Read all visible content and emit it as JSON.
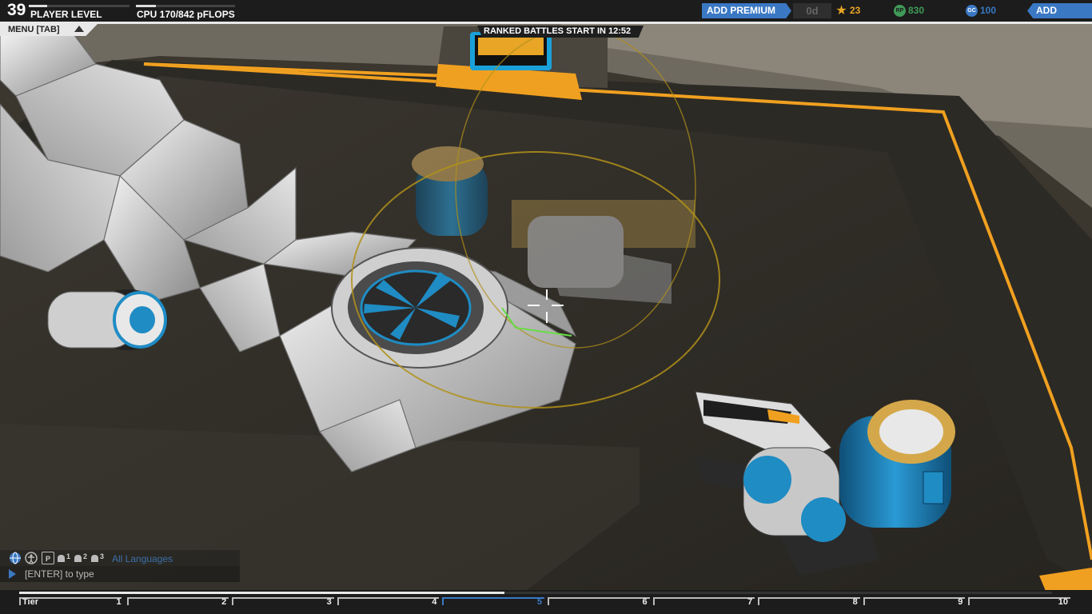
{
  "player": {
    "level": "39",
    "level_label": "PLAYER LEVEL",
    "level_progress": 0.18
  },
  "cpu": {
    "label": "CPU 170/842 pFLOPS",
    "progress": 0.2
  },
  "premium": {
    "button_label": "ADD PREMIUM",
    "days": "0d"
  },
  "currencies": [
    {
      "name": "star",
      "icon": "star-icon",
      "value": "23",
      "color": "#e8a526"
    },
    {
      "name": "rp",
      "icon": "rp-icon",
      "value": "830",
      "color": "#3f9a58",
      "icon_text": "RP"
    },
    {
      "name": "gc",
      "icon": "gc-icon",
      "value": "100",
      "color": "#3a78c4",
      "icon_text": "GC"
    }
  ],
  "funds": {
    "button_label": "ADD FUNDS"
  },
  "menu": {
    "label": "MENU [TAB]"
  },
  "ranked": {
    "label": "RANKED BATTLES START IN 12:52"
  },
  "chat": {
    "icons": [
      "globe-icon",
      "person-icon",
      "party-icon",
      "user1-icon",
      "user2-icon",
      "user3-icon"
    ],
    "icon_text": [
      "",
      "",
      "P",
      "1",
      "2",
      "3"
    ],
    "channel": "All Languages",
    "input_placeholder": "[ENTER] to type"
  },
  "tier": {
    "label": "Tier",
    "ticks": [
      "1",
      "2",
      "3",
      "4",
      "5",
      "6",
      "7",
      "8",
      "9",
      "10"
    ],
    "highlight": "5",
    "progress": 0.47
  },
  "colors": {
    "accent_blue": "#3a78c4",
    "accent_orange": "#f0a020",
    "selection_green": "#66dd44"
  }
}
